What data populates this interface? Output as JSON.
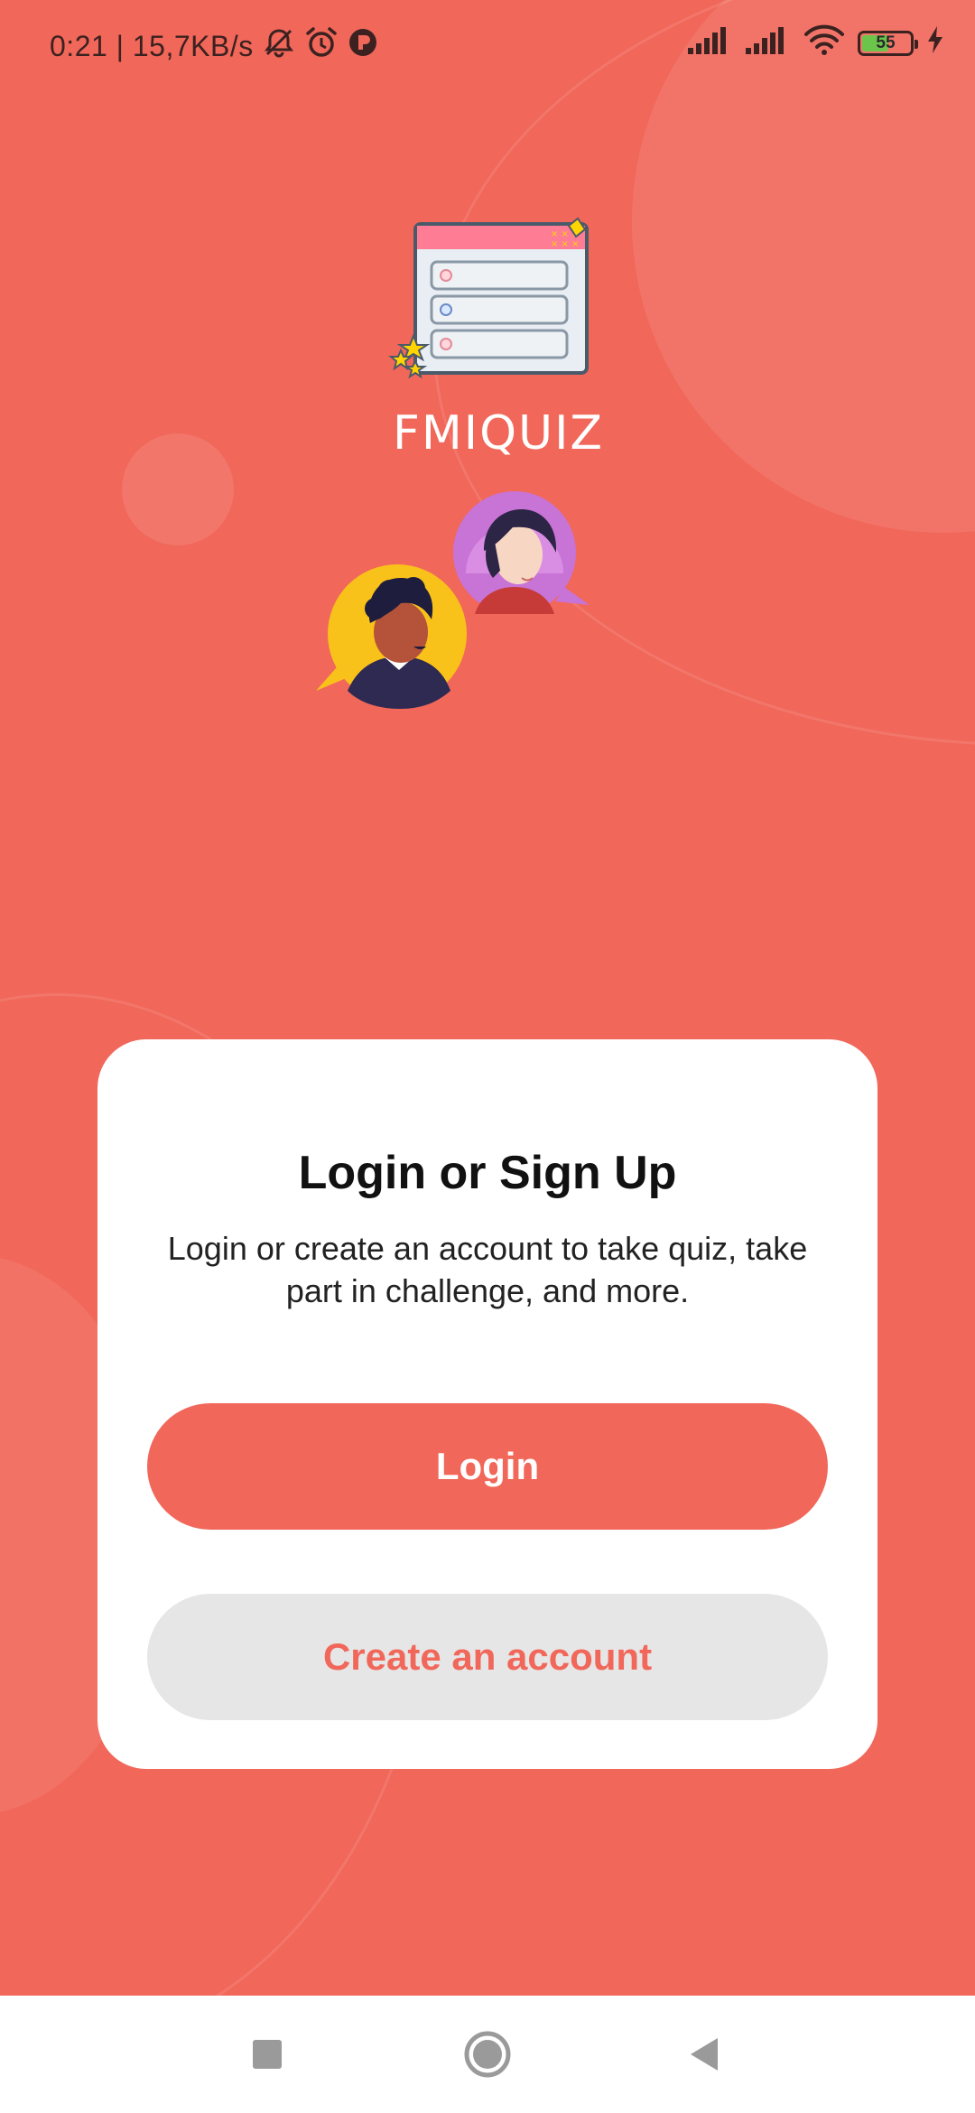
{
  "status_bar": {
    "time_speed": "0:21 | 15,7KB/s",
    "battery_level": "55",
    "battery_fraction": 0.55,
    "icons_left": [
      "bell-muted-icon",
      "alarm-icon",
      "app-notification-icon"
    ],
    "icons_right": [
      "signal-icon",
      "signal-icon",
      "wifi-icon",
      "battery-icon",
      "charging-icon"
    ]
  },
  "app": {
    "title": "FMIQUIZ"
  },
  "card": {
    "title": "Login or Sign Up",
    "description": "Login or create an account to take quiz, take part in challenge, and more.",
    "login_label": "Login",
    "create_label": "Create an account"
  },
  "navigation": {
    "buttons": [
      "recents-square-icon",
      "home-circle-icon",
      "back-triangle-icon"
    ]
  },
  "colors": {
    "background": "#f1675a",
    "card": "#ffffff",
    "primary": "#f1675a",
    "secondary_button": "#e6e6e6",
    "nav_bar": "#ffffff"
  }
}
